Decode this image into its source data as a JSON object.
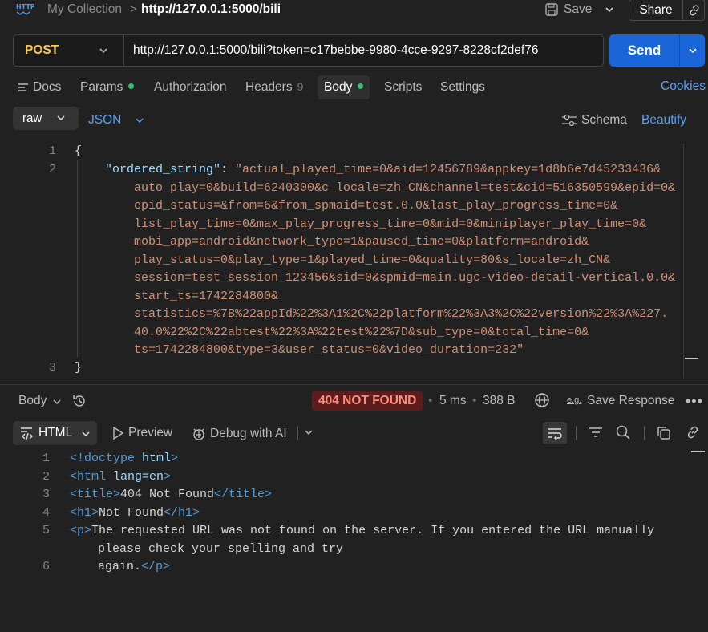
{
  "topbar": {
    "protocol_icon": "HTTP",
    "collection": "My Collection",
    "separator": ">",
    "request_name": "http://127.0.0.1:5000/bili",
    "save_label": "Save",
    "share_label": "Share"
  },
  "request": {
    "method": "POST",
    "url": "http://127.0.0.1:5000/bili?token=c17bebbe-9980-4cce-9297-8228cf2def76",
    "send_label": "Send"
  },
  "tabs": {
    "docs": "Docs",
    "params": "Params",
    "authorization": "Authorization",
    "headers": "Headers",
    "headers_count": "9",
    "body": "Body",
    "scripts": "Scripts",
    "settings": "Settings",
    "cookies": "Cookies"
  },
  "body_options": {
    "mode": "raw",
    "format": "JSON",
    "schema_label": "Schema",
    "beautify_label": "Beautify"
  },
  "editor": {
    "line_numbers": [
      "1",
      "2",
      "3"
    ],
    "open_brace": "{",
    "close_brace": "}",
    "key": "\"ordered_string\"",
    "colon": ": ",
    "value_lines": [
      "\"actual_played_time=0&aid=12456789&appkey=1d8b6e7d45233436&",
      "auto_play=0&build=6240300&c_locale=zh_CN&channel=test&cid=516350599&epid=0&",
      "epid_status=&from=6&from_spmaid=test.0.0&last_play_progress_time=0&",
      "list_play_time=0&max_play_progress_time=0&mid=0&miniplayer_play_time=0&",
      "mobi_app=android&network_type=1&paused_time=0&platform=android&",
      "play_status=0&play_type=1&played_time=0&quality=80&s_locale=zh_CN&",
      "session=test_session_123456&sid=0&spmid=main.ugc-video-detail-vertical.0.0&",
      "start_ts=1742284800&",
      "statistics=%7B%22appId%22%3A1%2C%22platform%22%3A3%2C%22version%22%3A%227.",
      "40.0%22%2C%22abtest%22%3A%22test%22%7D&sub_type=0&total_time=0&",
      "ts=1742284800&type=3&user_status=0&video_duration=232\""
    ]
  },
  "response": {
    "body_label": "Body",
    "status": "404 NOT FOUND",
    "time": "5 ms",
    "size": "388 B",
    "save_response_label": "Save Response",
    "eg_label": "e.g.",
    "more_label": "•••",
    "view_mode": "HTML",
    "preview_label": "Preview",
    "debug_label": "Debug with AI",
    "line_numbers": [
      "1",
      "2",
      "3",
      "4",
      "5",
      "6"
    ],
    "code": {
      "l1_tag": "<!doctype",
      "l1_rest": " html",
      "l1_end": ">",
      "l2_tag": "<html",
      "l2_attr": " lang",
      "l2_eq": "=en",
      "l2_end": ">",
      "l3_open": "<title>",
      "l3_text": "404 Not Found",
      "l3_close": "</title>",
      "l4_open": "<h1>",
      "l4_text": "Not Found",
      "l4_close": "</h1>",
      "l5_open": "<p>",
      "l5_text": "The requested URL was not found on the server. If you entered the URL manually",
      "l5_cont": "please check your spelling and try",
      "l6_text": "again.",
      "l6_close": "</p>"
    }
  },
  "colors": {
    "accent": "#1a66d9",
    "link": "#5aa0f5",
    "method": "#f8c952",
    "status_bg": "#5c1c1c",
    "status_fg": "#ff8c7a",
    "string": "#ce9178",
    "key": "#9cdcfe",
    "tag": "#569cd6",
    "dot": "#3dbd6f"
  },
  "icons": [
    "http-icon",
    "chevron-right-icon",
    "save-icon",
    "chevron-down-icon",
    "link-icon",
    "docs-icon",
    "schema-icon",
    "history-icon",
    "globe-icon",
    "code-icon",
    "play-icon",
    "debug-ai-icon",
    "wrap-icon",
    "filter-icon",
    "search-icon",
    "copy-icon"
  ]
}
